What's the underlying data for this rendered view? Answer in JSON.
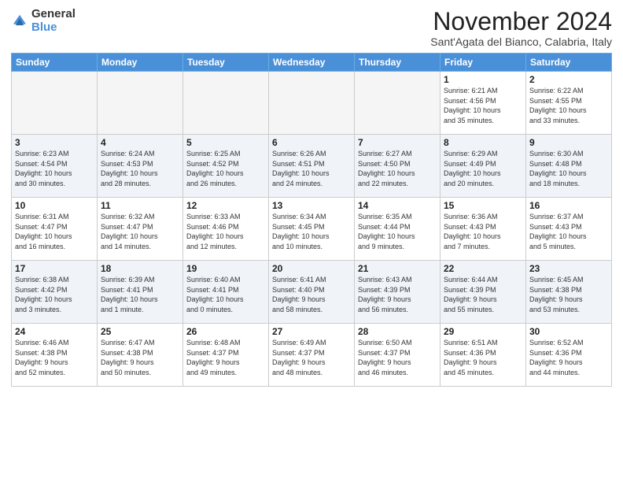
{
  "header": {
    "logo_general": "General",
    "logo_blue": "Blue",
    "title": "November 2024",
    "location": "Sant'Agata del Bianco, Calabria, Italy"
  },
  "weekdays": [
    "Sunday",
    "Monday",
    "Tuesday",
    "Wednesday",
    "Thursday",
    "Friday",
    "Saturday"
  ],
  "weeks": [
    [
      {
        "day": "",
        "info": ""
      },
      {
        "day": "",
        "info": ""
      },
      {
        "day": "",
        "info": ""
      },
      {
        "day": "",
        "info": ""
      },
      {
        "day": "",
        "info": ""
      },
      {
        "day": "1",
        "info": "Sunrise: 6:21 AM\nSunset: 4:56 PM\nDaylight: 10 hours\nand 35 minutes."
      },
      {
        "day": "2",
        "info": "Sunrise: 6:22 AM\nSunset: 4:55 PM\nDaylight: 10 hours\nand 33 minutes."
      }
    ],
    [
      {
        "day": "3",
        "info": "Sunrise: 6:23 AM\nSunset: 4:54 PM\nDaylight: 10 hours\nand 30 minutes."
      },
      {
        "day": "4",
        "info": "Sunrise: 6:24 AM\nSunset: 4:53 PM\nDaylight: 10 hours\nand 28 minutes."
      },
      {
        "day": "5",
        "info": "Sunrise: 6:25 AM\nSunset: 4:52 PM\nDaylight: 10 hours\nand 26 minutes."
      },
      {
        "day": "6",
        "info": "Sunrise: 6:26 AM\nSunset: 4:51 PM\nDaylight: 10 hours\nand 24 minutes."
      },
      {
        "day": "7",
        "info": "Sunrise: 6:27 AM\nSunset: 4:50 PM\nDaylight: 10 hours\nand 22 minutes."
      },
      {
        "day": "8",
        "info": "Sunrise: 6:29 AM\nSunset: 4:49 PM\nDaylight: 10 hours\nand 20 minutes."
      },
      {
        "day": "9",
        "info": "Sunrise: 6:30 AM\nSunset: 4:48 PM\nDaylight: 10 hours\nand 18 minutes."
      }
    ],
    [
      {
        "day": "10",
        "info": "Sunrise: 6:31 AM\nSunset: 4:47 PM\nDaylight: 10 hours\nand 16 minutes."
      },
      {
        "day": "11",
        "info": "Sunrise: 6:32 AM\nSunset: 4:47 PM\nDaylight: 10 hours\nand 14 minutes."
      },
      {
        "day": "12",
        "info": "Sunrise: 6:33 AM\nSunset: 4:46 PM\nDaylight: 10 hours\nand 12 minutes."
      },
      {
        "day": "13",
        "info": "Sunrise: 6:34 AM\nSunset: 4:45 PM\nDaylight: 10 hours\nand 10 minutes."
      },
      {
        "day": "14",
        "info": "Sunrise: 6:35 AM\nSunset: 4:44 PM\nDaylight: 10 hours\nand 9 minutes."
      },
      {
        "day": "15",
        "info": "Sunrise: 6:36 AM\nSunset: 4:43 PM\nDaylight: 10 hours\nand 7 minutes."
      },
      {
        "day": "16",
        "info": "Sunrise: 6:37 AM\nSunset: 4:43 PM\nDaylight: 10 hours\nand 5 minutes."
      }
    ],
    [
      {
        "day": "17",
        "info": "Sunrise: 6:38 AM\nSunset: 4:42 PM\nDaylight: 10 hours\nand 3 minutes."
      },
      {
        "day": "18",
        "info": "Sunrise: 6:39 AM\nSunset: 4:41 PM\nDaylight: 10 hours\nand 1 minute."
      },
      {
        "day": "19",
        "info": "Sunrise: 6:40 AM\nSunset: 4:41 PM\nDaylight: 10 hours\nand 0 minutes."
      },
      {
        "day": "20",
        "info": "Sunrise: 6:41 AM\nSunset: 4:40 PM\nDaylight: 9 hours\nand 58 minutes."
      },
      {
        "day": "21",
        "info": "Sunrise: 6:43 AM\nSunset: 4:39 PM\nDaylight: 9 hours\nand 56 minutes."
      },
      {
        "day": "22",
        "info": "Sunrise: 6:44 AM\nSunset: 4:39 PM\nDaylight: 9 hours\nand 55 minutes."
      },
      {
        "day": "23",
        "info": "Sunrise: 6:45 AM\nSunset: 4:38 PM\nDaylight: 9 hours\nand 53 minutes."
      }
    ],
    [
      {
        "day": "24",
        "info": "Sunrise: 6:46 AM\nSunset: 4:38 PM\nDaylight: 9 hours\nand 52 minutes."
      },
      {
        "day": "25",
        "info": "Sunrise: 6:47 AM\nSunset: 4:38 PM\nDaylight: 9 hours\nand 50 minutes."
      },
      {
        "day": "26",
        "info": "Sunrise: 6:48 AM\nSunset: 4:37 PM\nDaylight: 9 hours\nand 49 minutes."
      },
      {
        "day": "27",
        "info": "Sunrise: 6:49 AM\nSunset: 4:37 PM\nDaylight: 9 hours\nand 48 minutes."
      },
      {
        "day": "28",
        "info": "Sunrise: 6:50 AM\nSunset: 4:37 PM\nDaylight: 9 hours\nand 46 minutes."
      },
      {
        "day": "29",
        "info": "Sunrise: 6:51 AM\nSunset: 4:36 PM\nDaylight: 9 hours\nand 45 minutes."
      },
      {
        "day": "30",
        "info": "Sunrise: 6:52 AM\nSunset: 4:36 PM\nDaylight: 9 hours\nand 44 minutes."
      }
    ]
  ]
}
